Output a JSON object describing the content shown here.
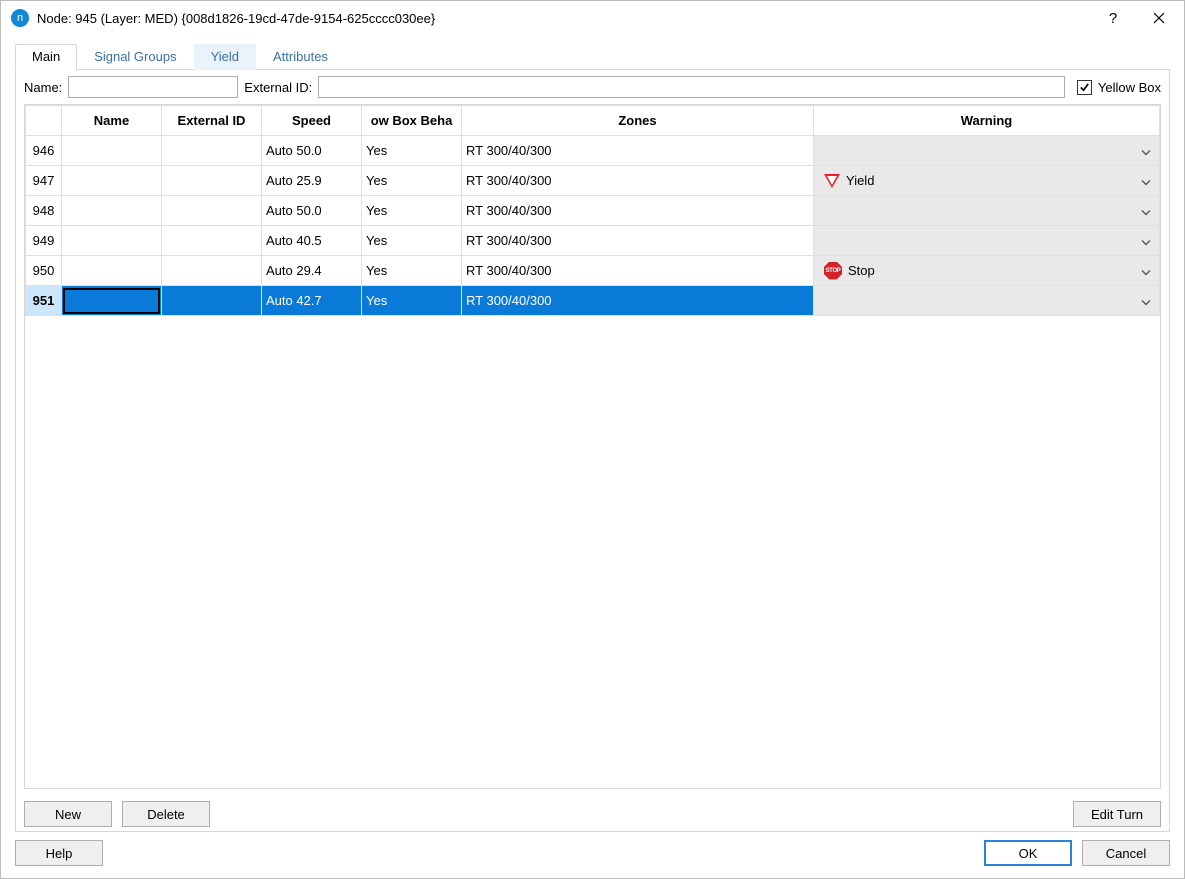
{
  "window": {
    "title": "Node: 945 (Layer: MED) {008d1826-19cd-47de-9154-625cccc030ee}"
  },
  "tabs": {
    "main": "Main",
    "signal_groups": "Signal Groups",
    "yield": "Yield",
    "attributes": "Attributes"
  },
  "form": {
    "name_label": "Name:",
    "name_value": "",
    "external_id_label": "External ID:",
    "external_id_value": "",
    "yellow_box_label": "Yellow Box",
    "yellow_box_checked": true
  },
  "table": {
    "headers": {
      "row": "",
      "name": "Name",
      "external_id": "External ID",
      "speed": "Speed",
      "yellow_box_behaviour": "ow Box Beha",
      "zones": "Zones",
      "warning": "Warning"
    },
    "rows": [
      {
        "id": "946",
        "name": "",
        "external_id": "",
        "speed": "Auto 50.0",
        "ybb": "Yes",
        "zones": "RT 300/40/300",
        "warning": ""
      },
      {
        "id": "947",
        "name": "",
        "external_id": "",
        "speed": "Auto 25.9",
        "ybb": "Yes",
        "zones": "RT 300/40/300",
        "warning": "Yield"
      },
      {
        "id": "948",
        "name": "",
        "external_id": "",
        "speed": "Auto 50.0",
        "ybb": "Yes",
        "zones": "RT 300/40/300",
        "warning": ""
      },
      {
        "id": "949",
        "name": "",
        "external_id": "",
        "speed": "Auto 40.5",
        "ybb": "Yes",
        "zones": "RT 300/40/300",
        "warning": ""
      },
      {
        "id": "950",
        "name": "",
        "external_id": "",
        "speed": "Auto 29.4",
        "ybb": "Yes",
        "zones": "RT 300/40/300",
        "warning": "Stop"
      },
      {
        "id": "951",
        "name": "",
        "external_id": "",
        "speed": "Auto 42.7",
        "ybb": "Yes",
        "zones": "RT 300/40/300",
        "warning": ""
      }
    ],
    "selected_row_id": "951"
  },
  "buttons": {
    "new": "New",
    "delete": "Delete",
    "edit_turn": "Edit Turn",
    "help": "Help",
    "ok": "OK",
    "cancel": "Cancel"
  },
  "icons": {
    "stop_text": "STOP"
  }
}
